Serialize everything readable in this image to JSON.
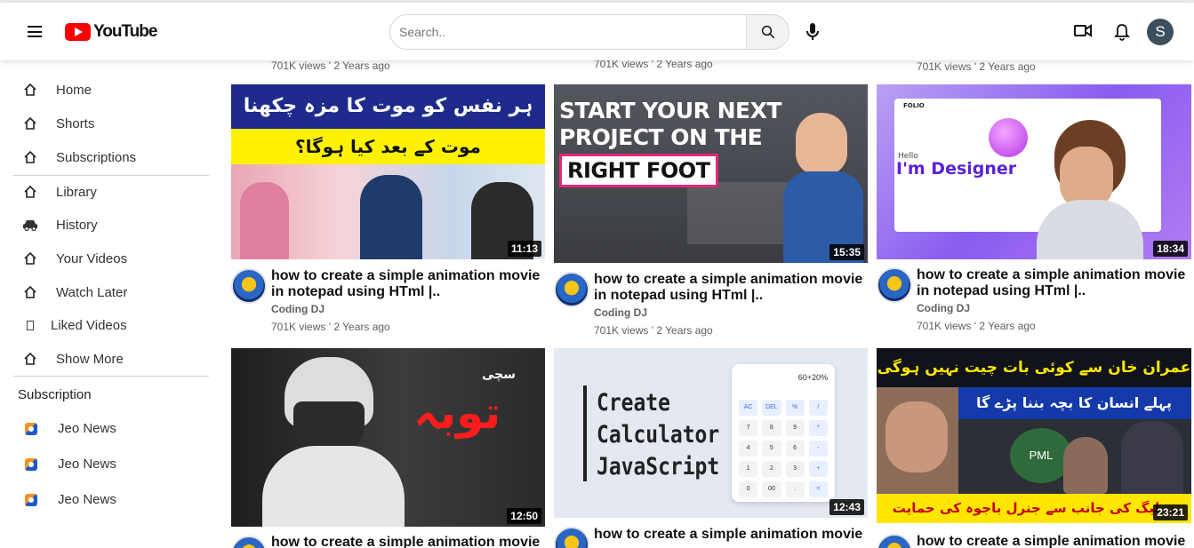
{
  "header": {
    "logo_text": "YouTube",
    "search_placeholder": "Search..",
    "avatar_letter": "S"
  },
  "sidebar": {
    "items": [
      {
        "label": "Home",
        "icon": "home-icon"
      },
      {
        "label": "Shorts",
        "icon": "home-icon"
      },
      {
        "label": "Subscriptions",
        "icon": "home-icon"
      },
      {
        "label": "Library",
        "icon": "home-icon"
      },
      {
        "label": "History",
        "icon": "car-icon"
      },
      {
        "label": "Your Videos",
        "icon": "home-icon"
      },
      {
        "label": "Watch Later",
        "icon": "home-icon"
      },
      {
        "label": "Liked Videos",
        "icon": "missing-glyph-icon"
      },
      {
        "label": "Show More",
        "icon": "home-icon"
      }
    ],
    "subscription_heading": "Subscription",
    "subscriptions": [
      {
        "label": "Jeo News",
        "icon": "geo-news-icon"
      },
      {
        "label": "Jeo News",
        "icon": "geo-news-icon"
      },
      {
        "label": "Jeo News",
        "icon": "geo-news-icon"
      }
    ]
  },
  "top_row_meta": [
    "701K views ' 2 Years ago",
    "701K views ' 2 Years ago",
    "701K views ' 2 Years ago"
  ],
  "videos": [
    {
      "title": "how to create a simple animation movie in notepad using HTml |..",
      "channel": "Coding DJ",
      "meta": "701K views ' 2 Years ago",
      "duration": "11:13",
      "thumb_text_1": "ہر نفس کو موت کا مزہ چکھنا ہے",
      "thumb_text_2": "موت کے بعد کیا ہوگا؟"
    },
    {
      "title": "how to create a simple animation movie in notepad using HTml |..",
      "channel": "Coding DJ",
      "meta": "701K views ' 2 Years ago",
      "duration": "15:35",
      "thumb_text_1": "START YOUR NEXT",
      "thumb_text_2": "PROJECT ON THE",
      "thumb_text_3": "RIGHT FOOT"
    },
    {
      "title": "how to create a simple animation movie in notepad using HTml |..",
      "channel": "Coding DJ",
      "meta": "701K views ' 2 Years ago",
      "duration": "18:34",
      "thumb_text_1": "FOLIO",
      "thumb_text_2": "I'm Designer",
      "thumb_text_3": "Hello"
    },
    {
      "title": "how to create a simple animation movie",
      "duration": "12:50",
      "thumb_text_1": "سچی",
      "thumb_text_2": "توبہ"
    },
    {
      "title": "how to create a simple animation movie",
      "duration": "12:43",
      "thumb_text_1": "Create",
      "thumb_text_2": "Calculator",
      "thumb_text_3": "JavaScript",
      "calc_display": "60+20%",
      "calc_keys": [
        "AC",
        "DEL",
        "%",
        "/",
        "7",
        "8",
        "9",
        "*",
        "4",
        "5",
        "6",
        "-",
        "1",
        "2",
        "3",
        "+",
        "0",
        "00",
        ".",
        "="
      ]
    },
    {
      "title": "how to create a simple animation movie",
      "duration": "23:21",
      "thumb_text_1": "عمران خان سے کوئی بات چیت نہیں ہوگی",
      "thumb_text_2": "پہلے انسان کا بچہ بننا پڑے گا",
      "thumb_text_3": "ن لیگ کی جانب سے جنرل باجوہ کی حمایت",
      "thumb_text_4": "PML"
    }
  ]
}
